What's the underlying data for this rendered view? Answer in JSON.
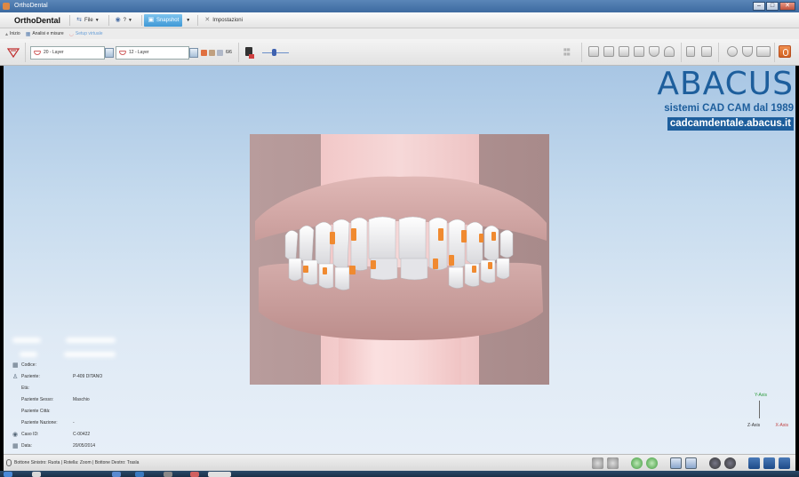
{
  "window": {
    "title": "OrthoDental",
    "buttons": {
      "minimize": "–",
      "maximize": "□",
      "close": "✕"
    }
  },
  "menubar": {
    "brand": "OrthoDental",
    "items": [
      {
        "label": "File",
        "icon": "file-icon"
      },
      {
        "label": "?",
        "icon": "help-icon"
      },
      {
        "label": "Snapshot",
        "icon": "snapshot-icon"
      },
      {
        "label": "Impostazioni",
        "icon": "settings-icon"
      }
    ]
  },
  "tabs": [
    {
      "label": "Inizio",
      "icon": "home-icon"
    },
    {
      "label": "Analisi e misure",
      "icon": "analysis-icon"
    },
    {
      "label": "Setup virtuale",
      "icon": "setup-icon"
    }
  ],
  "toolbar": {
    "layer_upper": "20 - Layer",
    "layer_lower": "12 - Layer",
    "counter": "6/6"
  },
  "branding": {
    "logo": "ABACUS",
    "tagline": "sistemi CAD CAM dal 1989",
    "url": "cadcamdentale.abacus.it"
  },
  "patient_info": {
    "rows": [
      {
        "icon": "code-icon",
        "label": "Codice:",
        "value": ""
      },
      {
        "icon": "patient-icon",
        "label": "Paziente:",
        "value": "P-409 DITANO"
      },
      {
        "icon": "",
        "label": "Età:",
        "value": ""
      },
      {
        "icon": "",
        "label": "Paziente Sesso:",
        "value": "Maschio"
      },
      {
        "icon": "",
        "label": "Paziente Città:",
        "value": ""
      },
      {
        "icon": "",
        "label": "Paziente Nazione:",
        "value": "-"
      },
      {
        "icon": "case-icon",
        "label": "Caso ID:",
        "value": "C-00422"
      },
      {
        "icon": "calendar-icon",
        "label": "Data:",
        "value": "20/05/2014"
      }
    ]
  },
  "axis": {
    "y": "Y-Axis",
    "z": "Z-Axis",
    "x": "X-Axis"
  },
  "statusbar": {
    "hint": "Bottone Sinistro: Ruota | Rotella: Zoom | Bottone Destro: Trasla"
  },
  "colors": {
    "accent": "#3f98d6",
    "brand": "#1d5e9c",
    "bracket": "#f08a30",
    "gum": "#d8aeac"
  }
}
